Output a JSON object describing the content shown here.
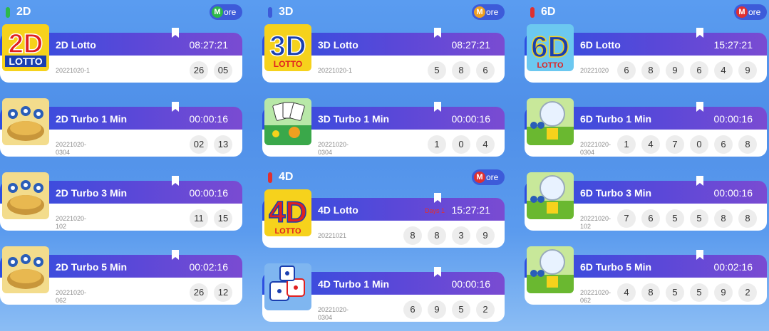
{
  "sections": {
    "d2": {
      "title": "2D",
      "marker_color": "#2db84a",
      "more_badge": "M",
      "more_label": "ore",
      "more_color": "#2db84a",
      "cards": [
        {
          "name": "2D Lotto",
          "time": "08:27:21",
          "draw": "20221020-1",
          "balls": [
            "26",
            "05"
          ]
        },
        {
          "name": "2D Turbo 1 Min",
          "time": "00:00:16",
          "draw": "20221020-0304",
          "balls": [
            "02",
            "13"
          ]
        },
        {
          "name": "2D Turbo 3 Min",
          "time": "00:00:16",
          "draw": "20221020-102",
          "balls": [
            "11",
            "15"
          ]
        },
        {
          "name": "2D Turbo 5 Min",
          "time": "00:02:16",
          "draw": "20221020-062",
          "balls": [
            "26",
            "12"
          ]
        }
      ]
    },
    "d3": {
      "title": "3D",
      "marker_color": "#3d5bd9",
      "more_badge": "M",
      "more_label": "ore",
      "more_color": "#f0a020",
      "cards": [
        {
          "name": "3D Lotto",
          "time": "08:27:21",
          "draw": "20221020-1",
          "balls": [
            "5",
            "8",
            "6"
          ]
        },
        {
          "name": "3D Turbo 1 Min",
          "time": "00:00:16",
          "draw": "20221020-0304",
          "balls": [
            "1",
            "0",
            "4"
          ]
        }
      ]
    },
    "d4": {
      "title": "4D",
      "marker_color": "#e03030",
      "more_badge": "M",
      "more_label": "ore",
      "more_color": "#e03030",
      "cards": [
        {
          "name": "4D Lotto",
          "time": "15:27:21",
          "draw": "20221021",
          "balls": [
            "8",
            "8",
            "3",
            "9"
          ],
          "note": "Days 1"
        },
        {
          "name": "4D Turbo 1 Min",
          "time": "00:00:16",
          "draw": "20221020-0304",
          "balls": [
            "6",
            "9",
            "5",
            "2"
          ]
        }
      ]
    },
    "d6": {
      "title": "6D",
      "marker_color": "#e03030",
      "more_badge": "M",
      "more_label": "ore",
      "more_color": "#e03030",
      "cards": [
        {
          "name": "6D Lotto",
          "time": "15:27:21",
          "draw": "20221020",
          "balls": [
            "6",
            "8",
            "9",
            "6",
            "4",
            "9"
          ]
        },
        {
          "name": "6D Turbo 1 Min",
          "time": "00:00:16",
          "draw": "20221020-0304",
          "balls": [
            "1",
            "4",
            "7",
            "0",
            "6",
            "8"
          ]
        },
        {
          "name": "6D Turbo 3 Min",
          "time": "00:00:16",
          "draw": "20221020-102",
          "balls": [
            "7",
            "6",
            "5",
            "5",
            "8",
            "8"
          ]
        },
        {
          "name": "6D Turbo 5 Min",
          "time": "00:02:16",
          "draw": "20221020-062",
          "balls": [
            "4",
            "8",
            "5",
            "5",
            "9",
            "2"
          ]
        }
      ]
    }
  },
  "logos": {
    "d2": "2D",
    "d3": "3D",
    "d4": "4D",
    "d6": "6D",
    "lotto": "LOTTO"
  }
}
